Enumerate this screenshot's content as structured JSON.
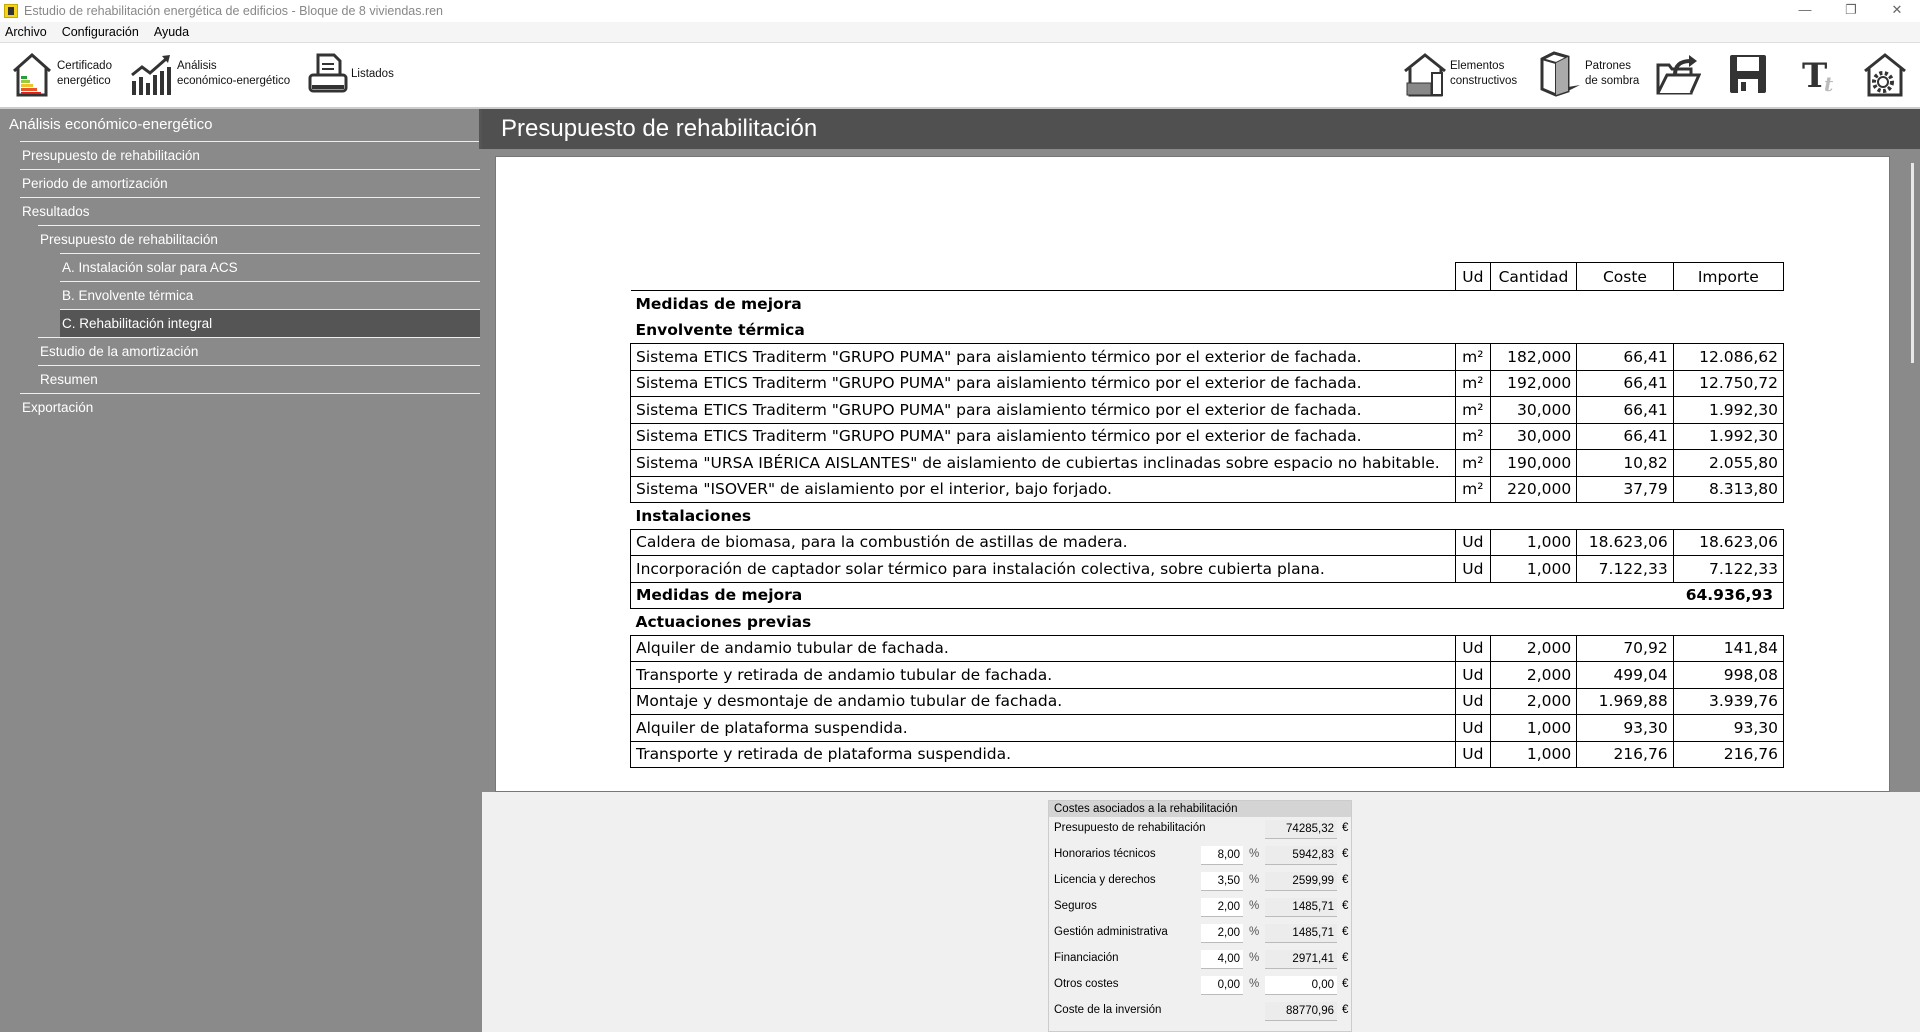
{
  "window": {
    "title": "Estudio de rehabilitación energética de edificios - Bloque de 8 viviendas.ren"
  },
  "menu": [
    "Archivo",
    "Configuración",
    "Ayuda"
  ],
  "toolbar": {
    "certificado": [
      "Certificado",
      "energético"
    ],
    "analisis": [
      "Análisis",
      "económico-energético"
    ],
    "listados": "Listados",
    "elementos": [
      "Elementos",
      "constructivos"
    ],
    "patrones": [
      "Patrones",
      "de sombra"
    ]
  },
  "sidebar": {
    "top": "Análisis económico-energético",
    "items": [
      {
        "label": "Presupuesto de rehabilitación",
        "level": 1
      },
      {
        "label": "Periodo de amortización",
        "level": 1
      },
      {
        "label": "Resultados",
        "level": 1
      },
      {
        "label": "Presupuesto de rehabilitación",
        "level": 2
      },
      {
        "label": "A. Instalación solar para ACS",
        "level": 3
      },
      {
        "label": "B. Envolvente térmica",
        "level": 3
      },
      {
        "label": "C. Rehabilitación integral",
        "level": 3,
        "selected": true
      },
      {
        "label": "Estudio de la amortización",
        "level": 2
      },
      {
        "label": "Resumen",
        "level": 2
      },
      {
        "label": "Exportación",
        "level": 1
      }
    ]
  },
  "header": {
    "title": "Presupuesto de rehabilitación"
  },
  "table": {
    "columns": [
      "Ud",
      "Cantidad",
      "Coste",
      "Importe"
    ],
    "rows": [
      {
        "type": "section",
        "text": "Medidas de mejora"
      },
      {
        "type": "section",
        "text": "Envolvente  térmica"
      },
      {
        "type": "item",
        "desc": "Sistema ETICS Traditerm \"GRUPO PUMA\" para aislamiento térmico por el exterior de fachada.",
        "ud": "m²",
        "cantidad": "182,000",
        "coste": "66,41",
        "importe": "12.086,62"
      },
      {
        "type": "item",
        "desc": "Sistema ETICS Traditerm \"GRUPO PUMA\" para aislamiento térmico por el exterior de fachada.",
        "ud": "m²",
        "cantidad": "192,000",
        "coste": "66,41",
        "importe": "12.750,72"
      },
      {
        "type": "item",
        "desc": "Sistema ETICS Traditerm \"GRUPO PUMA\" para aislamiento térmico por el exterior de fachada.",
        "ud": "m²",
        "cantidad": "30,000",
        "coste": "66,41",
        "importe": "1.992,30"
      },
      {
        "type": "item",
        "desc": "Sistema ETICS Traditerm \"GRUPO PUMA\" para aislamiento térmico por el exterior de fachada.",
        "ud": "m²",
        "cantidad": "30,000",
        "coste": "66,41",
        "importe": "1.992,30"
      },
      {
        "type": "item",
        "desc": "Sistema \"URSA IBÉRICA AISLANTES\" de aislamiento de cubiertas inclinadas sobre espacio no habitable.",
        "ud": "m²",
        "cantidad": "190,000",
        "coste": "10,82",
        "importe": "2.055,80"
      },
      {
        "type": "item",
        "desc": "Sistema \"ISOVER\" de aislamiento por el interior, bajo forjado.",
        "ud": "m²",
        "cantidad": "220,000",
        "coste": "37,79",
        "importe": "8.313,80"
      },
      {
        "type": "section",
        "text": "Instalaciones"
      },
      {
        "type": "item",
        "desc": "Caldera de biomasa, para la combustión de astillas de madera.",
        "ud": "Ud",
        "cantidad": "1,000",
        "coste": "18.623,06",
        "importe": "18.623,06"
      },
      {
        "type": "item",
        "desc": "Incorporación de captador solar térmico para instalación colectiva, sobre cubierta plana.",
        "ud": "Ud",
        "cantidad": "1,000",
        "coste": "7.122,33",
        "importe": "7.122,33"
      },
      {
        "type": "total",
        "text": "Medidas de mejora",
        "importe": "64.936,93"
      },
      {
        "type": "section",
        "text": "Actuaciones  previas"
      },
      {
        "type": "item",
        "desc": "Alquiler de andamio tubular de fachada.",
        "ud": "Ud",
        "cantidad": "2,000",
        "coste": "70,92",
        "importe": "141,84"
      },
      {
        "type": "item",
        "desc": "Transporte y retirada de andamio tubular de fachada.",
        "ud": "Ud",
        "cantidad": "2,000",
        "coste": "499,04",
        "importe": "998,08"
      },
      {
        "type": "item",
        "desc": "Montaje y desmontaje de andamio tubular de fachada.",
        "ud": "Ud",
        "cantidad": "2,000",
        "coste": "1.969,88",
        "importe": "3.939,76"
      },
      {
        "type": "item",
        "desc": "Alquiler de plataforma suspendida.",
        "ud": "Ud",
        "cantidad": "1,000",
        "coste": "93,30",
        "importe": "93,30"
      },
      {
        "type": "item",
        "desc": "Transporte y retirada de plataforma suspendida.",
        "ud": "Ud",
        "cantidad": "1,000",
        "coste": "216,76",
        "importe": "216,76"
      }
    ]
  },
  "costs": {
    "title": "Costes asociados a la rehabilitación",
    "pct_unit": "%",
    "currency": "€",
    "rows": [
      {
        "label": "Presupuesto de rehabilitación",
        "value": "74285,32"
      },
      {
        "label": "Honorarios técnicos",
        "pct": "8,00",
        "value": "5942,83"
      },
      {
        "label": "Licencia y derechos",
        "pct": "3,50",
        "value": "2599,99"
      },
      {
        "label": "Seguros",
        "pct": "2,00",
        "value": "1485,71"
      },
      {
        "label": "Gestión administrativa",
        "pct": "2,00",
        "value": "1485,71"
      },
      {
        "label": "Financiación",
        "pct": "4,00",
        "value": "2971,41"
      },
      {
        "label": "Otros costes",
        "pct": "0,00",
        "value": "0,00",
        "editable": true
      },
      {
        "label": "Coste de la inversión",
        "value": "88770,96"
      }
    ]
  }
}
